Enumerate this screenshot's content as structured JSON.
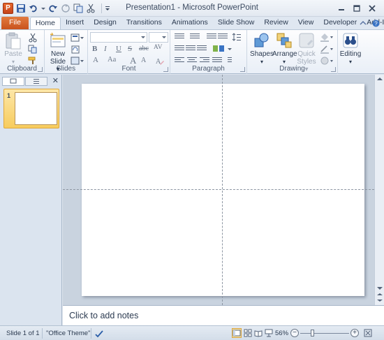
{
  "window": {
    "app_logo_letter": "P",
    "title": "Presentation1  -  Microsoft PowerPoint"
  },
  "ribbon_tabs": [
    {
      "label": "File"
    },
    {
      "label": "Home"
    },
    {
      "label": "Insert"
    },
    {
      "label": "Design"
    },
    {
      "label": "Transitions"
    },
    {
      "label": "Animations"
    },
    {
      "label": "Slide Show"
    },
    {
      "label": "Review"
    },
    {
      "label": "View"
    },
    {
      "label": "Developer"
    },
    {
      "label": "Add-Ins"
    }
  ],
  "active_tab": "Home",
  "groups": {
    "clipboard": {
      "label": "Clipboard",
      "paste_label": "Paste"
    },
    "slides": {
      "label": "Slides",
      "new_slide_label_1": "New",
      "new_slide_label_2": "Slide"
    },
    "font": {
      "label": "Font",
      "bold": "B",
      "italic": "I",
      "underline": "U",
      "strike": "S",
      "abc": "abc",
      "av": "AV",
      "font_color": "A",
      "case": "Aa",
      "grow": "A",
      "shrink": "A"
    },
    "paragraph": {
      "label": "Paragraph"
    },
    "drawing": {
      "label": "Drawing",
      "shapes_label": "Shapes",
      "arrange_label": "Arrange",
      "quick_label_1": "Quick",
      "quick_label_2": "Styles"
    },
    "editing": {
      "label": "Editing"
    }
  },
  "slides_pane": {
    "thumbnails": [
      {
        "number": "1"
      }
    ]
  },
  "notes": {
    "placeholder": "Click to add notes"
  },
  "status": {
    "slide_info": "Slide 1 of 1",
    "theme": "\"Office Theme\"",
    "zoom": "56%",
    "zoom_fraction": 0.56
  },
  "colors": {
    "file_tab": "#d2602a",
    "thumb_selected": "#f7cc5e",
    "accent": "#2b579a"
  },
  "icons": [
    "save-icon",
    "undo-icon",
    "redo-icon",
    "cut-icon",
    "copy-icon",
    "format-painter-icon",
    "minimize-icon",
    "restore-icon",
    "close-icon",
    "help-icon"
  ]
}
